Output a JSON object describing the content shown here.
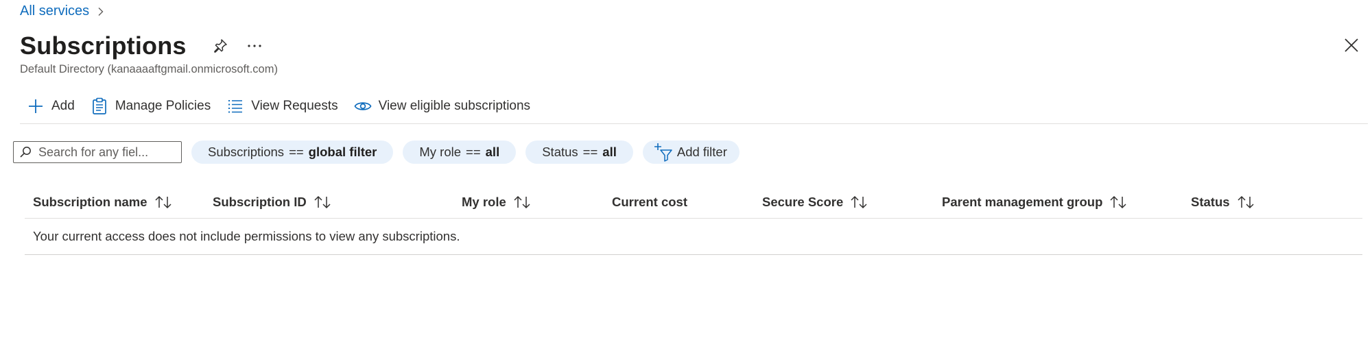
{
  "breadcrumb": {
    "all_services": "All services"
  },
  "header": {
    "title": "Subscriptions",
    "subtitle": "Default Directory (kanaaaaftgmail.onmicrosoft.com)",
    "more_label": "···"
  },
  "toolbar": {
    "add": "Add",
    "manage_policies": "Manage Policies",
    "view_requests": "View Requests",
    "view_eligible": "View eligible subscriptions"
  },
  "filters": {
    "search_placeholder": "Search for any fiel...",
    "subscriptions": {
      "key": "Subscriptions",
      "op": "==",
      "value": "global filter"
    },
    "my_role": {
      "key": "My role",
      "op": "==",
      "value": "all"
    },
    "status": {
      "key": "Status",
      "op": "==",
      "value": "all"
    },
    "add_filter": "Add filter"
  },
  "table": {
    "columns": [
      "Subscription name",
      "Subscription ID",
      "My role",
      "Current cost",
      "Secure Score",
      "Parent management group",
      "Status"
    ],
    "empty_message": "Your current access does not include permissions to view any subscriptions."
  },
  "colors": {
    "accent": "#0f6cbd",
    "pill_bg": "#e8f1fb",
    "text": "#323130"
  }
}
